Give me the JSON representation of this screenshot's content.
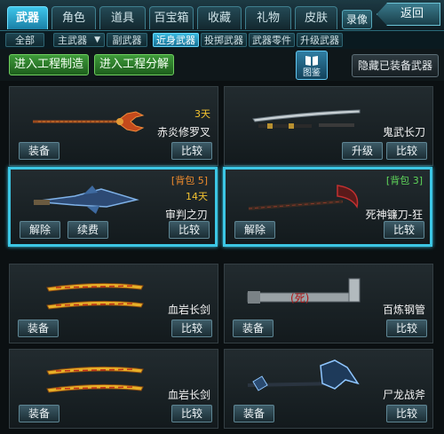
{
  "tabs": [
    {
      "label": "武器",
      "active": true
    },
    {
      "label": "角色"
    },
    {
      "label": "道具"
    },
    {
      "label": "百宝箱"
    },
    {
      "label": "收藏"
    },
    {
      "label": "礼物"
    },
    {
      "label": "皮肤"
    }
  ],
  "record_label": "录像",
  "back_label": "返回",
  "subtabs": {
    "all": "全部",
    "primary_select": "主武器",
    "secondary": "副武器",
    "melee": "近身武器",
    "throwing": "投掷武器",
    "parts": "武器零件",
    "upgrade": "升级武器"
  },
  "actions": {
    "craft": "进入工程制造",
    "decompose": "进入工程分解",
    "catalog": "图鉴",
    "hide_equipped": "隐藏已装备武器"
  },
  "cards": [
    {
      "name": "赤炎修罗叉",
      "days": "3天",
      "badge": "",
      "buttons": [
        "装备",
        "比较"
      ]
    },
    {
      "name": "鬼武长刀",
      "days": "",
      "badge": "",
      "buttons": [
        "升级",
        "比较"
      ]
    },
    {
      "name": "审判之刃",
      "days": "14天",
      "badge": "[背包 5]",
      "buttons": [
        "解除",
        "续费",
        "比较"
      ],
      "selected": true
    },
    {
      "name": "死神镰刀-狂",
      "days": "",
      "badge": "[背包 3]",
      "buttons": [
        "解除",
        "比较"
      ],
      "selected": true
    },
    {
      "name": "血岩长剑",
      "days": "",
      "badge": "",
      "buttons": [
        "装备",
        "比较"
      ]
    },
    {
      "name": "百炼钢管",
      "days": "",
      "badge": "",
      "buttons": [
        "装备",
        "比较"
      ]
    },
    {
      "name": "血岩长剑",
      "days": "",
      "badge": "",
      "buttons": [
        "装备",
        "比较"
      ]
    },
    {
      "name": "尸龙战斧",
      "days": "",
      "badge": "",
      "buttons": [
        "装备",
        "比较"
      ]
    }
  ],
  "colors": {
    "accent": "#3cc6e4",
    "days": "#f2c230",
    "badge_orange": "#f08b2c",
    "badge_green": "#5fd65a",
    "green_button": "#3e9a3a"
  }
}
